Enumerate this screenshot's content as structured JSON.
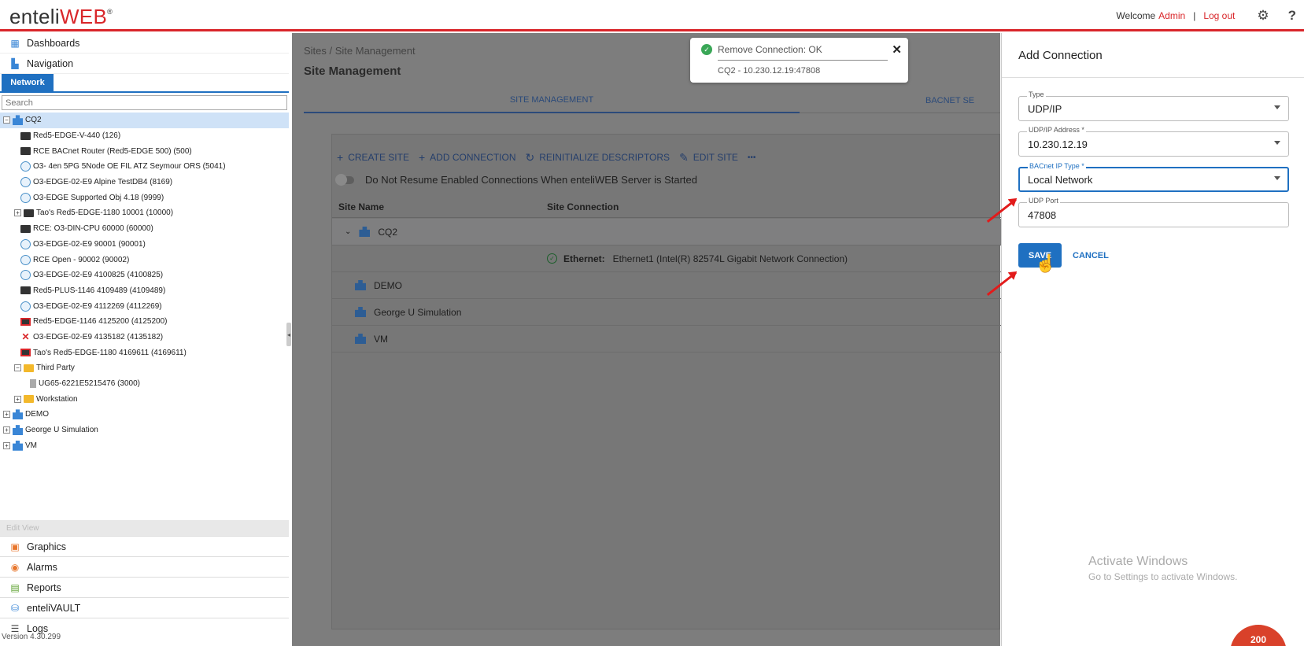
{
  "header": {
    "logo_prefix": "enteli",
    "logo_suffix": "WEB",
    "logo_mark": "®",
    "welcome": "Welcome",
    "user": "Admin",
    "separator": "|",
    "logout": "Log out",
    "settings_icon": "gear-icon",
    "help": "?"
  },
  "sidebar": {
    "top_items": [
      {
        "label": "Dashboards",
        "icon": "dashboard-icon"
      },
      {
        "label": "Navigation",
        "icon": "navigation-icon"
      }
    ],
    "network_tab": "Network",
    "search_placeholder": "Search",
    "tree": [
      {
        "label": "CQ2",
        "depth": 0,
        "icon": "building",
        "expander": "−",
        "selected": true
      },
      {
        "label": "Red5-EDGE-V-440 (126)",
        "depth": 2,
        "icon": "device"
      },
      {
        "label": "RCE BACnet Router (Red5-EDGE 500) (500)",
        "depth": 2,
        "icon": "device"
      },
      {
        "label": "O3- 4en 5PG 5Node OE FIL ATZ Seymour ORS (5041)",
        "depth": 2,
        "icon": "circle"
      },
      {
        "label": "O3-EDGE-02-E9 Alpine TestDB4 (8169)",
        "depth": 2,
        "icon": "circle"
      },
      {
        "label": "O3-EDGE Supported Obj 4.18 (9999)",
        "depth": 2,
        "icon": "circle"
      },
      {
        "label": "Tao's Red5-EDGE-1180 10001 (10000)",
        "depth": 1,
        "icon": "device",
        "expander": "+"
      },
      {
        "label": "RCE: O3-DIN-CPU 60000 (60000)",
        "depth": 2,
        "icon": "device"
      },
      {
        "label": "O3-EDGE-02-E9 90001 (90001)",
        "depth": 2,
        "icon": "circle"
      },
      {
        "label": "RCE Open - 90002 (90002)",
        "depth": 2,
        "icon": "circle"
      },
      {
        "label": "O3-EDGE-02-E9 4100825 (4100825)",
        "depth": 2,
        "icon": "circle"
      },
      {
        "label": "Red5-PLUS-1146 4109489 (4109489)",
        "depth": 2,
        "icon": "device"
      },
      {
        "label": "O3-EDGE-02-E9 4112269 (4112269)",
        "depth": 2,
        "icon": "circle"
      },
      {
        "label": "Red5-EDGE-1146 4125200 (4125200)",
        "depth": 2,
        "icon": "device-red"
      },
      {
        "label": "O3-EDGE-02-E9 4135182 (4135182)",
        "depth": 2,
        "icon": "error"
      },
      {
        "label": "Tao's Red5-EDGE-1180 4169611 (4169611)",
        "depth": 2,
        "icon": "device-red"
      },
      {
        "label": "Third Party",
        "depth": 1,
        "icon": "folder",
        "expander": "−"
      },
      {
        "label": "UG65-6221E5215476 (3000)",
        "depth": 3,
        "icon": "doc"
      },
      {
        "label": "Workstation",
        "depth": 1,
        "icon": "folder",
        "expander": "+"
      },
      {
        "label": "DEMO",
        "depth": 0,
        "icon": "building",
        "expander": "+"
      },
      {
        "label": "George U Simulation",
        "depth": 0,
        "icon": "building",
        "expander": "+"
      },
      {
        "label": "VM",
        "depth": 0,
        "icon": "building",
        "expander": "+"
      }
    ],
    "edit_view": "Edit View",
    "bottom_items": [
      {
        "label": "Graphics",
        "icon": "graphics-icon",
        "color": "#e8762c"
      },
      {
        "label": "Alarms",
        "icon": "alarm-icon",
        "color": "#e8762c"
      },
      {
        "label": "Reports",
        "icon": "reports-icon",
        "color": "#5aa02c"
      },
      {
        "label": "enteliVAULT",
        "icon": "vault-icon",
        "color": "#3a86d6"
      },
      {
        "label": "Logs",
        "icon": "logs-icon",
        "color": "#444444"
      }
    ],
    "version": "Version 4.30.299"
  },
  "main": {
    "breadcrumb": "Sites  /  Site Management",
    "title": "Site Management",
    "tabs": [
      "SITE MANAGEMENT",
      "BACNET SE"
    ],
    "toolbar": {
      "create_site": "CREATE SITE",
      "add_connection": "ADD CONNECTION",
      "reinitialize": "REINITIALIZE DESCRIPTORS",
      "edit_site": "EDIT SITE",
      "more": "•••"
    },
    "toggle_label": "Do Not Resume Enabled Connections When enteliWEB Server is Started",
    "columns": [
      "Site Name",
      "Site Connection"
    ],
    "rows": {
      "cq2": "CQ2",
      "connection_label": "Ethernet:",
      "connection_value": "Ethernet1 (Intel(R) 82574L Gigabit Network Connection)",
      "demo": "DEMO",
      "george": "George U Simulation",
      "vm": "VM"
    }
  },
  "toast": {
    "title": "Remove Connection: OK",
    "detail": "CQ2 - 10.230.12.19:47808",
    "close": "✕"
  },
  "panel": {
    "title": "Add Connection",
    "fields": {
      "type": {
        "label": "Type",
        "value": "UDP/IP"
      },
      "address": {
        "label": "UDP/IP Address *",
        "value": "10.230.12.19"
      },
      "ip_type": {
        "label": "BACnet IP Type *",
        "value": "Local Network"
      },
      "port": {
        "label": "UDP Port",
        "value": "47808"
      }
    },
    "save": "SAVE",
    "cancel": "CANCEL",
    "watermark_title": "Activate Windows",
    "watermark_sub": "Go to Settings to activate Windows.",
    "badge": "200"
  },
  "colors": {
    "accent": "#1f70c1",
    "brand_red": "#d9262a",
    "annotation_arrow": "#e21b1b"
  }
}
